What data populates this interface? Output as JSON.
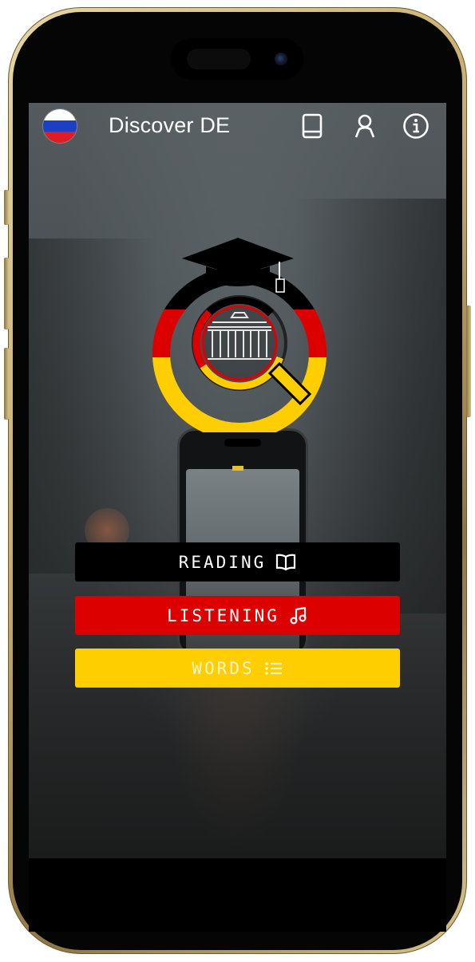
{
  "header": {
    "title": "Discover DE",
    "language_flag": "russia-flag-icon",
    "icons": [
      "book-icon",
      "user-icon",
      "info-icon"
    ]
  },
  "logo": {
    "name": "discover-de-logo",
    "colors": [
      "#000000",
      "#dd0000",
      "#ffce00"
    ]
  },
  "modes": {
    "reading": {
      "label": "READING",
      "icon": "open-book-icon",
      "color": "#000000"
    },
    "listening": {
      "label": "LISTENING",
      "icon": "music-note-icon",
      "color": "#dd0000"
    },
    "words": {
      "label": "WORDS",
      "icon": "list-icon",
      "color": "#ffce00"
    }
  },
  "flag_colors": [
    "#ffffff",
    "#1c3fc8",
    "#e01b24"
  ]
}
